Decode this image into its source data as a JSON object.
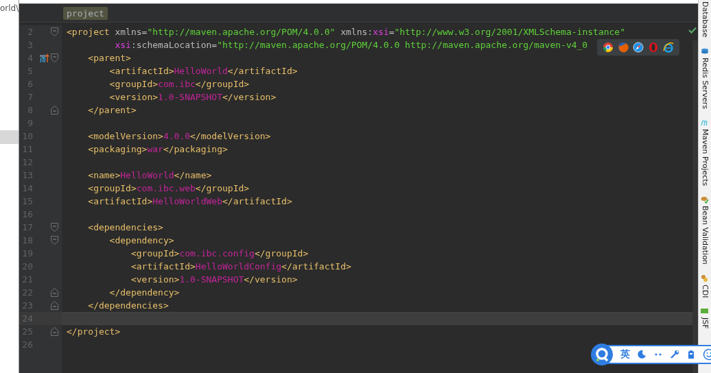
{
  "left_panel": {
    "path_text": "orld\\"
  },
  "breadcrumb": [
    {
      "label": "project",
      "selected": true
    }
  ],
  "editor": {
    "lines": [
      {
        "number": "2",
        "fold_start": true,
        "current": false,
        "tokens": [
          {
            "kind": "tag",
            "text": "<project "
          },
          {
            "kind": "attr",
            "text": "xmlns="
          },
          {
            "kind": "str",
            "text": "\"http://maven.apache.org/POM/4.0.0\""
          },
          {
            "kind": "attr",
            "text": " xmlns:"
          },
          {
            "kind": "ns",
            "text": "xsi"
          },
          {
            "kind": "attr",
            "text": "="
          },
          {
            "kind": "str",
            "text": "\"http://www.w3.org/2001/XMLSchema-instance\""
          }
        ]
      },
      {
        "number": "3",
        "current": false,
        "tokens": [
          {
            "kind": "ns",
            "text": "         xsi"
          },
          {
            "kind": "attr",
            "text": ":schemaLocation="
          },
          {
            "kind": "str",
            "text": "\"http://maven.apache.org/POM/4.0.0 http://maven.apache.org/maven-v4_0"
          }
        ]
      },
      {
        "number": "4",
        "fold_start": true,
        "maven_marker": true,
        "current": false,
        "tokens": [
          {
            "kind": "tag",
            "text": "    <parent>"
          }
        ]
      },
      {
        "number": "5",
        "current": false,
        "tokens": [
          {
            "kind": "tag",
            "text": "        <artifactId>"
          },
          {
            "kind": "value",
            "text": "HelloWorld"
          },
          {
            "kind": "tag",
            "text": "</artifactId>"
          }
        ]
      },
      {
        "number": "6",
        "current": false,
        "tokens": [
          {
            "kind": "tag",
            "text": "        <groupId>"
          },
          {
            "kind": "value",
            "text": "com.ibc"
          },
          {
            "kind": "tag",
            "text": "</groupId>"
          }
        ]
      },
      {
        "number": "7",
        "current": false,
        "tokens": [
          {
            "kind": "tag",
            "text": "        <version>"
          },
          {
            "kind": "value",
            "text": "1.0-SNAPSHOT"
          },
          {
            "kind": "tag",
            "text": "</version>"
          }
        ]
      },
      {
        "number": "8",
        "fold_end": true,
        "current": false,
        "tokens": [
          {
            "kind": "tag",
            "text": "    </parent>"
          }
        ]
      },
      {
        "number": "9",
        "current": false
      },
      {
        "number": "10",
        "current": false,
        "tokens": [
          {
            "kind": "tag",
            "text": "    <modelVersion>"
          },
          {
            "kind": "value",
            "text": "4.0.0"
          },
          {
            "kind": "tag",
            "text": "</modelVersion>"
          }
        ]
      },
      {
        "number": "11",
        "current": false,
        "tokens": [
          {
            "kind": "tag",
            "text": "    <packaging>"
          },
          {
            "kind": "value",
            "text": "war"
          },
          {
            "kind": "tag",
            "text": "</packaging>"
          }
        ]
      },
      {
        "number": "12",
        "current": false
      },
      {
        "number": "13",
        "current": false,
        "tokens": [
          {
            "kind": "tag",
            "text": "    <name>"
          },
          {
            "kind": "value",
            "text": "HelloWorld"
          },
          {
            "kind": "tag",
            "text": "</name>"
          }
        ]
      },
      {
        "number": "14",
        "current": false,
        "tokens": [
          {
            "kind": "tag",
            "text": "    <groupId>"
          },
          {
            "kind": "value",
            "text": "com.ibc.web"
          },
          {
            "kind": "tag",
            "text": "</groupId>"
          }
        ]
      },
      {
        "number": "15",
        "current": false,
        "tokens": [
          {
            "kind": "tag",
            "text": "    <artifactId>"
          },
          {
            "kind": "value",
            "text": "HelloWorldWeb"
          },
          {
            "kind": "tag",
            "text": "</artifactId>"
          }
        ]
      },
      {
        "number": "16",
        "current": false
      },
      {
        "number": "17",
        "fold_start": true,
        "current": false,
        "tokens": [
          {
            "kind": "tag",
            "text": "    <dependencies>"
          }
        ]
      },
      {
        "number": "18",
        "fold_start": true,
        "current": false,
        "tokens": [
          {
            "kind": "tag",
            "text": "        <dependency>"
          }
        ]
      },
      {
        "number": "19",
        "current": false,
        "tokens": [
          {
            "kind": "tag",
            "text": "            <groupId>"
          },
          {
            "kind": "value",
            "text": "com.ibc.config"
          },
          {
            "kind": "tag",
            "text": "</groupId>"
          }
        ]
      },
      {
        "number": "20",
        "current": false,
        "tokens": [
          {
            "kind": "tag",
            "text": "            <artifactId>"
          },
          {
            "kind": "value",
            "text": "HelloWorldConfig"
          },
          {
            "kind": "tag",
            "text": "</artifactId>"
          }
        ]
      },
      {
        "number": "21",
        "current": false,
        "tokens": [
          {
            "kind": "tag",
            "text": "            <version>"
          },
          {
            "kind": "value",
            "text": "1.0-SNAPSHOT"
          },
          {
            "kind": "tag",
            "text": "</version>"
          }
        ]
      },
      {
        "number": "22",
        "fold_end": true,
        "current": false,
        "tokens": [
          {
            "kind": "tag",
            "text": "        </dependency>"
          }
        ]
      },
      {
        "number": "23",
        "fold_end": true,
        "current": false,
        "tokens": [
          {
            "kind": "tag",
            "text": "    </dependencies>"
          }
        ]
      },
      {
        "number": "24",
        "current": true
      },
      {
        "number": "25",
        "fold_end": true,
        "current": false,
        "tokens": [
          {
            "kind": "tag",
            "text": "</project>"
          }
        ]
      },
      {
        "number": "26",
        "current": false
      }
    ]
  },
  "tool_window_strip": [
    {
      "label": "Database"
    },
    {
      "label": "Redis Servers"
    },
    {
      "label": "Maven Projects"
    },
    {
      "label": "Bean Validation"
    },
    {
      "label": "CDI"
    },
    {
      "label": "JSF"
    }
  ],
  "ime_toolbar": {
    "mode": "英"
  }
}
